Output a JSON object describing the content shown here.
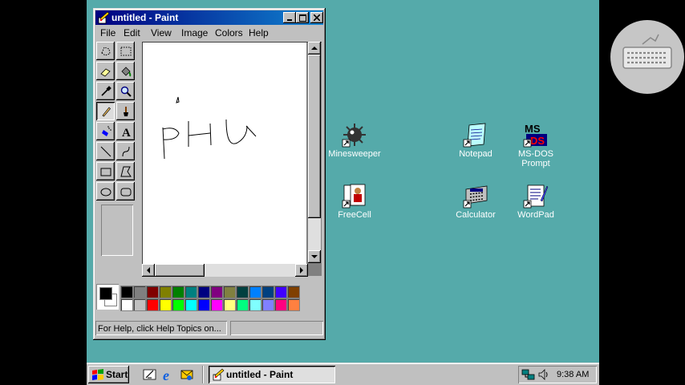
{
  "paint_window": {
    "title": "untitled - Paint",
    "menus": [
      "File",
      "Edit",
      "View",
      "Image",
      "Colors",
      "Help"
    ],
    "status_text": "For Help, click Help Topics on...",
    "palette_top": [
      "#000000",
      "#808080",
      "#800000",
      "#808000",
      "#008000",
      "#008080",
      "#000080",
      "#800080",
      "#808040",
      "#004040",
      "#0080ff",
      "#004080",
      "#4000ff",
      "#804000"
    ],
    "palette_bottom": [
      "#ffffff",
      "#c0c0c0",
      "#ff0000",
      "#ffff00",
      "#00ff00",
      "#00ffff",
      "#0000ff",
      "#ff00ff",
      "#ffff80",
      "#00ff80",
      "#80ffff",
      "#8080ff",
      "#ff0080",
      "#ff8040"
    ]
  },
  "desktop_icons": [
    {
      "label": "Minesweeper",
      "icon": "minesweeper-icon"
    },
    {
      "label": "Notepad",
      "icon": "notepad-icon"
    },
    {
      "label_line1": "MS-DOS",
      "label_line2": "Prompt",
      "icon": "msdos-icon"
    },
    {
      "label": "FreeCell",
      "icon": "freecell-icon"
    },
    {
      "label": "Calculator",
      "icon": "calculator-icon"
    },
    {
      "label": "WordPad",
      "icon": "wordpad-icon"
    }
  ],
  "taskbar": {
    "start_label": "Start",
    "task_label": "untitled - Paint",
    "clock": "9:38 AM"
  },
  "colors": {
    "desktop": "#55aaaa",
    "title_bar": "#000080",
    "face": "#c0c0c0"
  }
}
